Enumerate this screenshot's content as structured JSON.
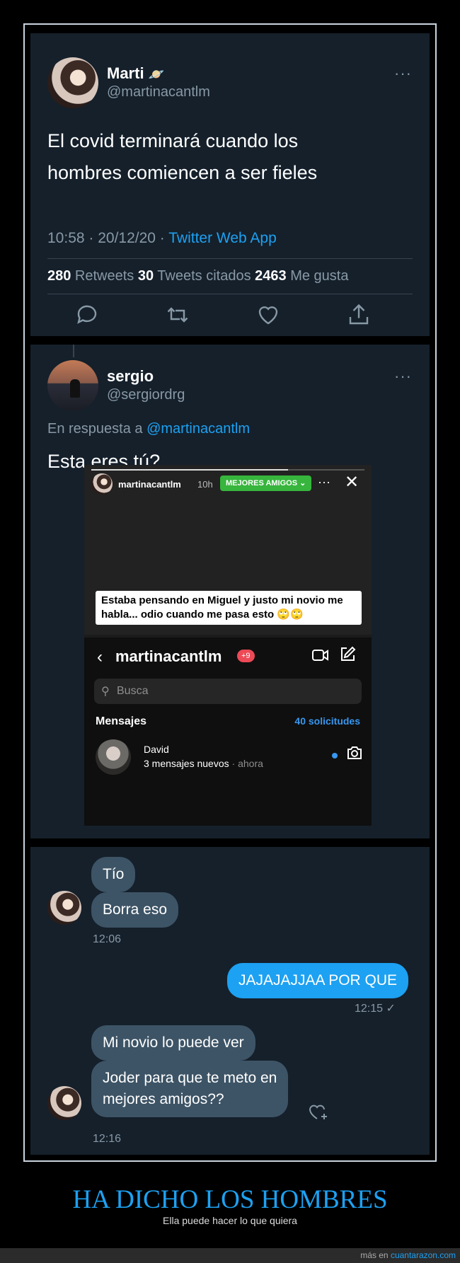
{
  "tweet1": {
    "name": "Marti",
    "name_emoji": "🪐",
    "handle": "@martinacantlm",
    "more": "···",
    "text_line1": "El covid terminará cuando los",
    "text_line2": "hombres comiencen a ser fieles",
    "timestamp": "10:58 · 20/12/20 · ",
    "source": "Twitter Web App",
    "retweets_count": "280",
    "retweets_label": " Retweets ",
    "quotes_count": "30",
    "quotes_label": " Tweets citados ",
    "likes_count": "2463",
    "likes_label": " Me gusta"
  },
  "tweet2": {
    "name": "sergio",
    "handle": "@sergiordrg",
    "more": "···",
    "reply_prefix": "En respuesta a ",
    "reply_to": "@martinacantlm",
    "text": "Esta eres tú?"
  },
  "story": {
    "username": "martinacantlm",
    "time": "10h",
    "badge": "MEJORES AMIGOS ⌄",
    "more": "···",
    "close": "✕",
    "caption": "Estaba pensando en Miguel y justo mi novio me habla... odio cuando me pasa esto 🙄🙄"
  },
  "instagram_dm": {
    "back": "‹",
    "title": "martinacantlm",
    "badge": "+9",
    "search_placeholder": "Busca",
    "messages_label": "Mensajes",
    "requests_label": "40 solicitudes",
    "thread": {
      "name": "David",
      "subtitle": "3 mensajes nuevos",
      "ago": " · ahora"
    }
  },
  "dm_chat": {
    "msg1": "Tío",
    "msg2": "Borra eso",
    "time1": "12:06",
    "msg3": "JAJAJAJJAA POR QUE",
    "time2": "12:15 ✓",
    "msg4": "Mi novio lo puede ver",
    "msg5_line1": "Joder para que te meto en",
    "msg5_line2": "mejores amigos??",
    "time3": "12:16"
  },
  "footer": {
    "title": "HA DICHO LOS HOMBRES",
    "subtitle": "Ella puede hacer lo que quiera",
    "more_prefix": "más en ",
    "site": "cuantarazon.com"
  },
  "colors": {
    "panel_bg": "#15202b",
    "accent": "#1da1f2",
    "muted": "#8899a6",
    "bubble_in": "#3d5466"
  }
}
